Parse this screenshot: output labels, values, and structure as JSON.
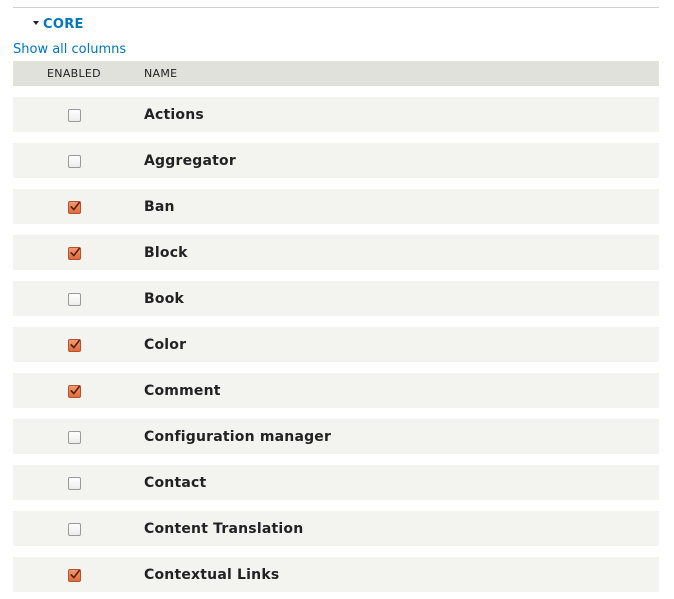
{
  "section": {
    "label": "CORE",
    "expanded": true
  },
  "show_all_columns_link": "Show all columns",
  "table": {
    "headers": {
      "enabled": "ENABLED",
      "name": "NAME"
    },
    "rows": [
      {
        "name": "Actions",
        "enabled": false
      },
      {
        "name": "Aggregator",
        "enabled": false
      },
      {
        "name": "Ban",
        "enabled": true
      },
      {
        "name": "Block",
        "enabled": true
      },
      {
        "name": "Book",
        "enabled": false
      },
      {
        "name": "Color",
        "enabled": true
      },
      {
        "name": "Comment",
        "enabled": true
      },
      {
        "name": "Configuration manager",
        "enabled": false
      },
      {
        "name": "Contact",
        "enabled": false
      },
      {
        "name": "Content Translation",
        "enabled": false
      },
      {
        "name": "Contextual Links",
        "enabled": true
      }
    ]
  },
  "colors": {
    "link": "#0074bd",
    "row_background": "#f3f3ef",
    "header_background": "#e1e1dc",
    "checked_fill": "#e5774a"
  }
}
